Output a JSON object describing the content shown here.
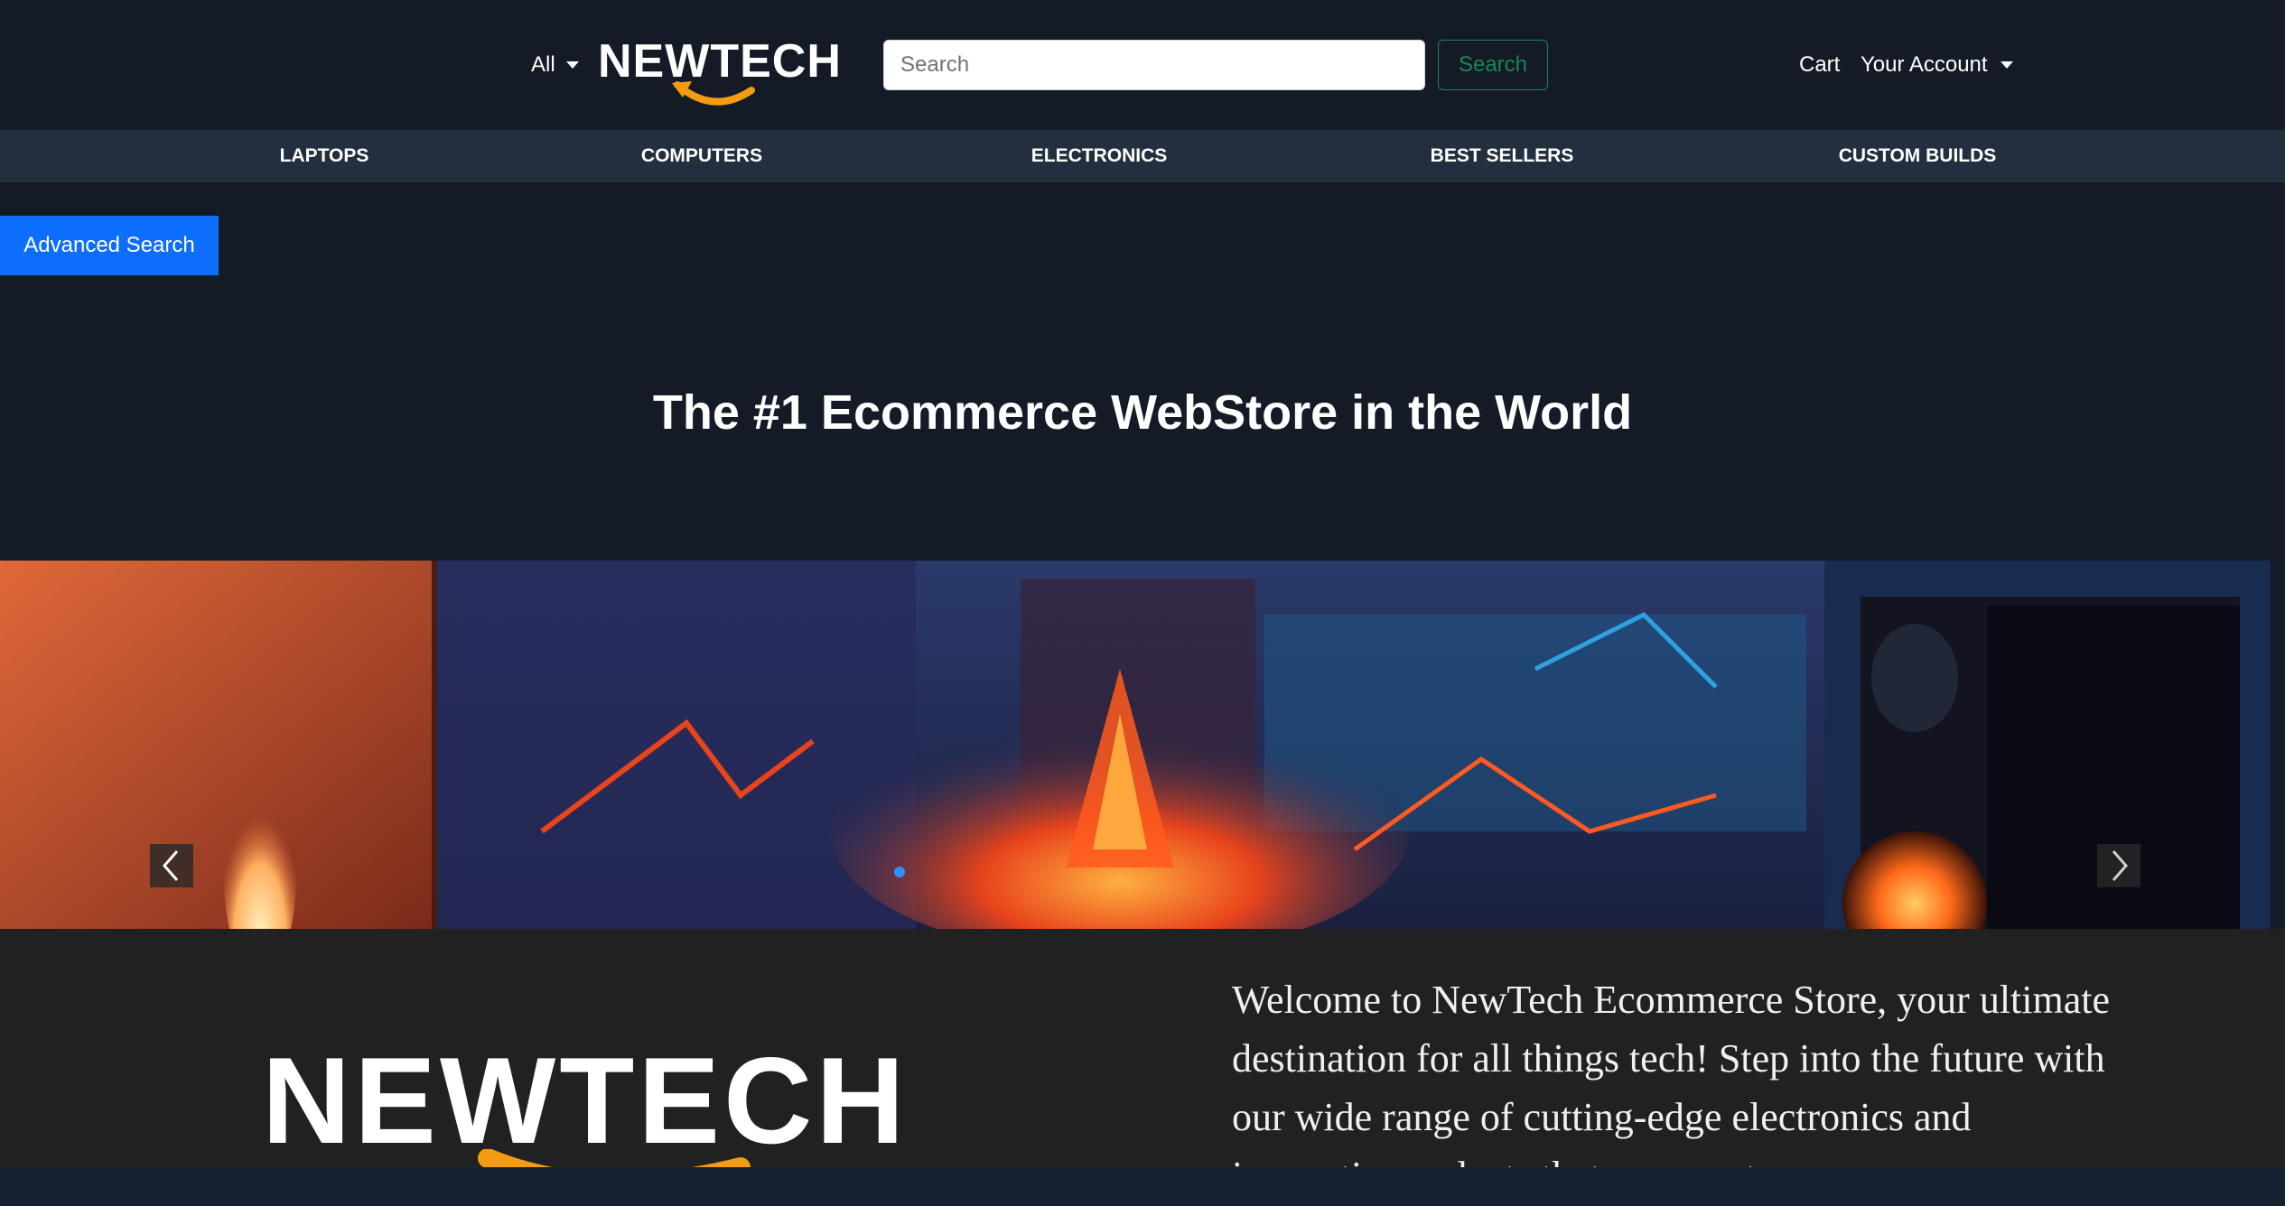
{
  "header": {
    "category_dropdown": "All",
    "logo_text": "NEWTECH",
    "search": {
      "placeholder": "Search",
      "value": "",
      "button_label": "Search"
    },
    "cart_label": "Cart",
    "account_label": "Your Account"
  },
  "nav": {
    "items": [
      {
        "label": "LAPTOPS"
      },
      {
        "label": "COMPUTERS"
      },
      {
        "label": "ELECTRONICS"
      },
      {
        "label": "BEST SELLERS"
      },
      {
        "label": "CUSTOM BUILDS"
      }
    ]
  },
  "advanced_search_label": "Advanced Search",
  "hero": {
    "title": "The #1 Ecommerce WebStore in the World"
  },
  "about": {
    "logo_text": "NEWTECH",
    "welcome_text": "Welcome to NewTech Ecommerce Store, your ultimate destination for all things tech! Step into the future with our wide range of cutting-edge electronics and innovative gadgets that are sure to"
  },
  "colors": {
    "page_bg": "#141b26",
    "nav_bg": "#232f3e",
    "accent_orange": "#f39c12",
    "primary_blue": "#0d6efd",
    "success_green": "#198754"
  },
  "icons": [
    "caret-down-icon",
    "logo-smile-icon",
    "chevron-left-icon",
    "chevron-right-icon"
  ]
}
